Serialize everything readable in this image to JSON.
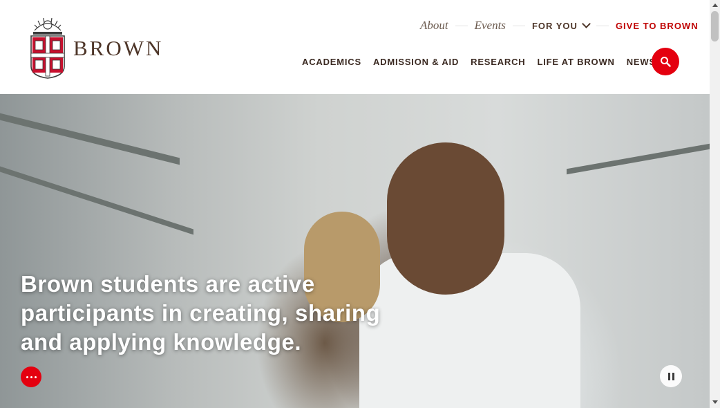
{
  "logo": {
    "wordmark": "BROWN",
    "icon": "brown-university-shield-icon"
  },
  "utility_nav": {
    "about": "About",
    "events": "Events",
    "for_you": "FOR YOU",
    "give": "GIVE TO BROWN"
  },
  "main_nav": {
    "items": [
      {
        "label": "ACADEMICS"
      },
      {
        "label": "ADMISSION & AID"
      },
      {
        "label": "RESEARCH"
      },
      {
        "label": "LIFE AT BROWN"
      },
      {
        "label": "NEWS"
      }
    ]
  },
  "search": {
    "icon": "search-icon"
  },
  "hero": {
    "headline": "Brown students are active participants in creating, sharing and applying knowledge.",
    "more_icon": "more-dots-icon",
    "pause_icon": "pause-icon"
  },
  "colors": {
    "brand_red": "#e4000f",
    "brand_brown": "#4e3629",
    "give_red": "#c00404"
  }
}
